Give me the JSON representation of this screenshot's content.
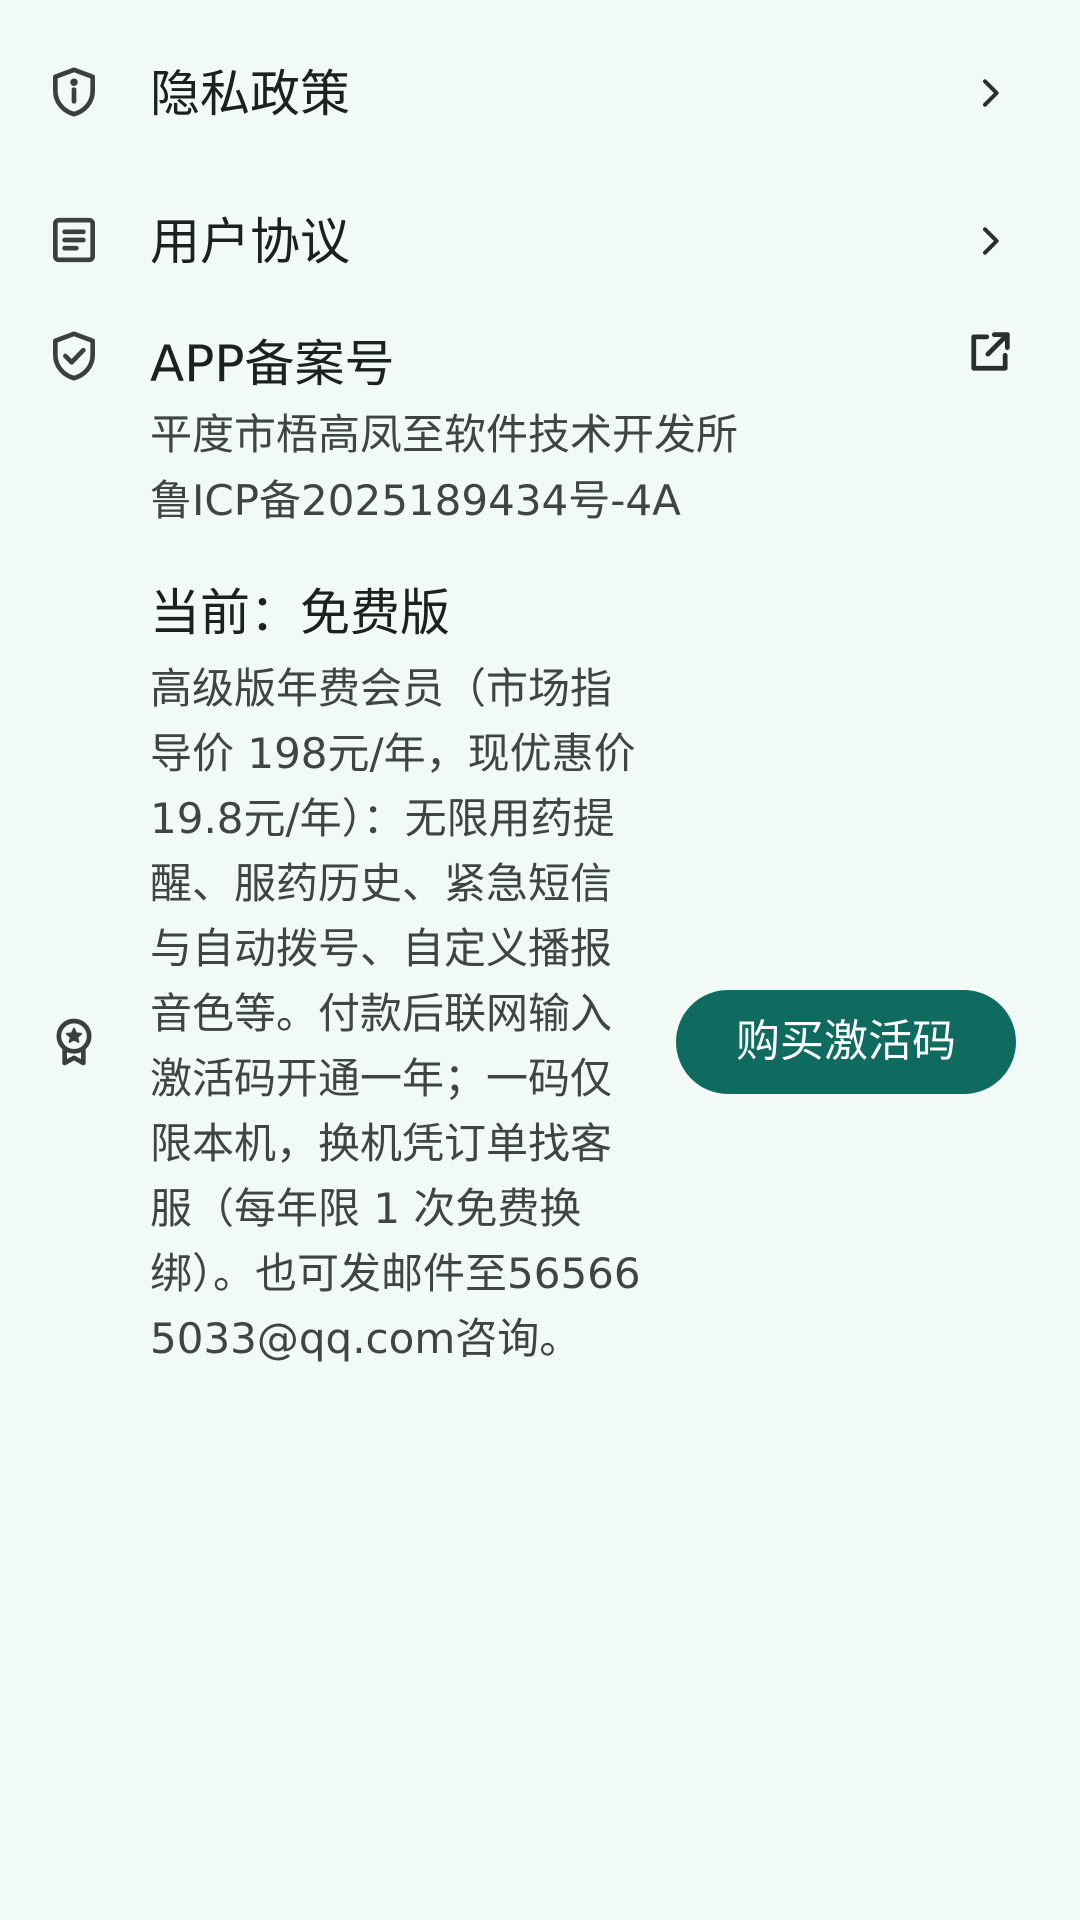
{
  "settings": {
    "privacy": {
      "label": "隐私政策",
      "icon": "shield-info-icon"
    },
    "agreement": {
      "label": "用户协议",
      "icon": "document-lines-icon"
    },
    "record": {
      "label": "APP备案号",
      "icon": "shield-check-icon",
      "action_icon": "open-external-icon",
      "company": "平度市梧高凤至软件技术开发所",
      "icp": "鲁ICP备2025189434号-4A"
    },
    "membership": {
      "icon": "award-star-icon",
      "current": "当前：免费版",
      "description": "高级版年费会员（市场指导价 198元/年，现优惠价 19.8元/年）：无限用药提醒、服药历史、紧急短信与自动拨号、自定义播报音色等。付款后联网输入激活码开通一年；一码仅限本机，换机凭订单找客服（每年限 1 次免费换绑）。也可发邮件至565665033@qq.com咨询。",
      "buy_button": "购买激活码"
    }
  },
  "colors": {
    "background": "#f2faf8",
    "accent": "#0f6a5f",
    "icon": "#3a403e"
  }
}
